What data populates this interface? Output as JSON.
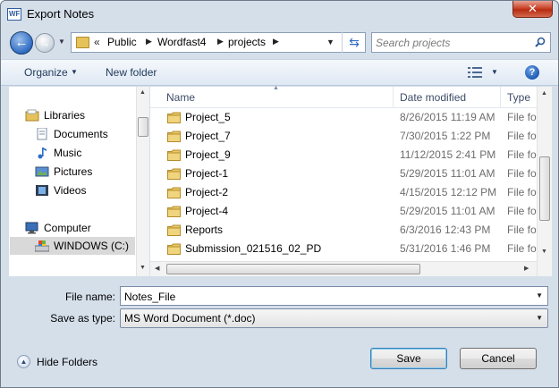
{
  "window": {
    "title": "Export Notes",
    "app_icon_text": "WF",
    "close_label": "✕"
  },
  "address_bar": {
    "overflow_chevron": "«",
    "breadcrumbs": [
      "Public",
      "Wordfast4",
      "projects"
    ]
  },
  "search": {
    "placeholder": "Search projects"
  },
  "toolbar": {
    "organize": "Organize",
    "new_folder": "New folder",
    "help": "?"
  },
  "nav_pane": {
    "items": [
      {
        "label": "Libraries",
        "icon": "libraries-icon"
      },
      {
        "label": "Documents",
        "icon": "documents-icon"
      },
      {
        "label": "Music",
        "icon": "music-icon"
      },
      {
        "label": "Pictures",
        "icon": "pictures-icon"
      },
      {
        "label": "Videos",
        "icon": "videos-icon"
      },
      {
        "label": "Computer",
        "icon": "computer-icon"
      },
      {
        "label": "WINDOWS (C:)",
        "icon": "drive-icon",
        "selected": true
      }
    ]
  },
  "file_list": {
    "columns": [
      "Name",
      "Date modified",
      "Type"
    ],
    "rows": [
      {
        "name": "Project_5",
        "date": "8/26/2015 11:19 AM",
        "type": "File folder"
      },
      {
        "name": "Project_7",
        "date": "7/30/2015 1:22 PM",
        "type": "File folder"
      },
      {
        "name": "Project_9",
        "date": "11/12/2015 2:41 PM",
        "type": "File folder"
      },
      {
        "name": "Project-1",
        "date": "5/29/2015 11:01 AM",
        "type": "File folder"
      },
      {
        "name": "Project-2",
        "date": "4/15/2015 12:12 PM",
        "type": "File folder"
      },
      {
        "name": "Project-4",
        "date": "5/29/2015 11:01 AM",
        "type": "File folder"
      },
      {
        "name": "Reports",
        "date": "6/3/2016 12:43 PM",
        "type": "File folder"
      },
      {
        "name": "Submission_021516_02_PD",
        "date": "5/31/2016 1:46 PM",
        "type": "File folder"
      }
    ]
  },
  "form": {
    "file_name_label": "File name:",
    "file_name_value": "Notes_File",
    "save_type_label": "Save as type:",
    "save_type_value": "MS Word Document (*.doc)"
  },
  "footer": {
    "hide_folders": "Hide Folders",
    "save": "Save",
    "cancel": "Cancel"
  },
  "colors": {
    "window_bg": "#d5dfea",
    "close_red": "#c9452a",
    "accent_blue": "#2f6bc2"
  }
}
